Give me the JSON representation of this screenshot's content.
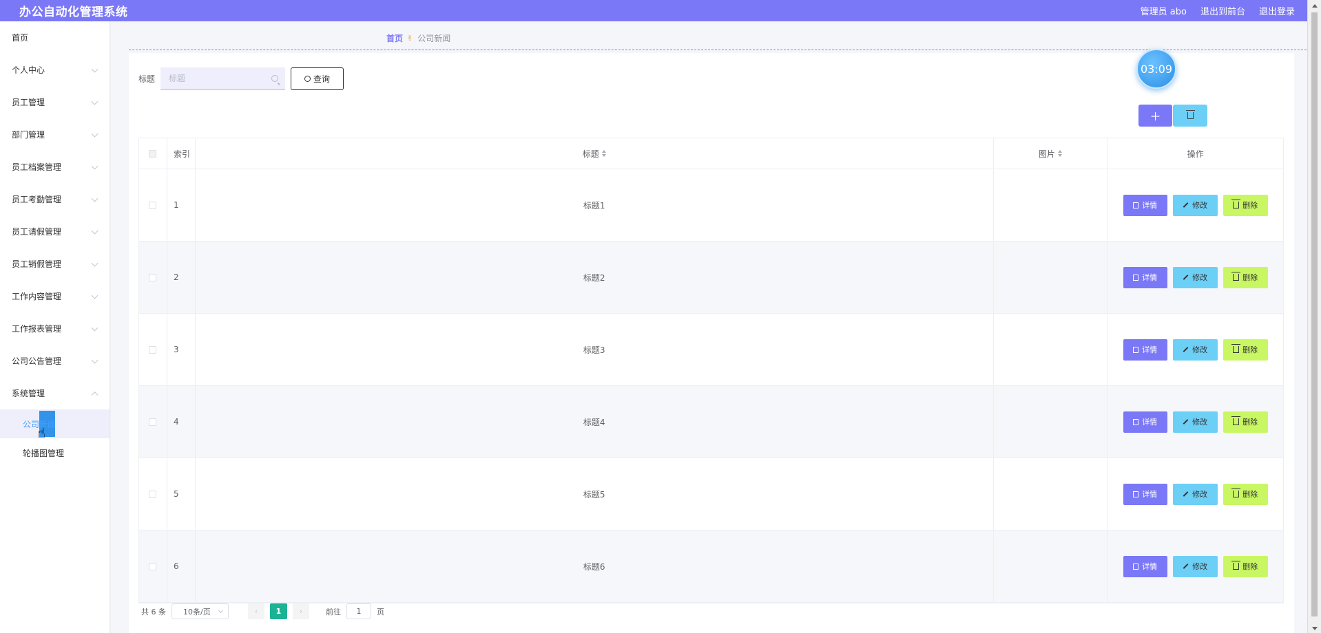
{
  "header": {
    "app_title": "办公自动化管理系统",
    "admin_label": "管理员 abo",
    "exit_front": "退出到前台",
    "logout": "退出登录"
  },
  "sidebar": {
    "items": [
      {
        "label": "首页",
        "expandable": false
      },
      {
        "label": "个人中心",
        "expandable": true
      },
      {
        "label": "员工管理",
        "expandable": true
      },
      {
        "label": "部门管理",
        "expandable": true
      },
      {
        "label": "员工档案管理",
        "expandable": true
      },
      {
        "label": "员工考勤管理",
        "expandable": true
      },
      {
        "label": "员工请假管理",
        "expandable": true
      },
      {
        "label": "员工销假管理",
        "expandable": true
      },
      {
        "label": "工作内容管理",
        "expandable": true
      },
      {
        "label": "工作报表管理",
        "expandable": true
      },
      {
        "label": "公司公告管理",
        "expandable": true
      },
      {
        "label": "系统管理",
        "expandable": true,
        "expanded": true
      }
    ],
    "subitems": [
      {
        "label": "公司新闻",
        "active": true
      },
      {
        "label": "轮播图管理",
        "active": false
      }
    ]
  },
  "breadcrumb": {
    "home": "首页",
    "current": "公司新闻"
  },
  "search": {
    "label": "标题",
    "placeholder": "标题",
    "value": "",
    "button_label": "查询"
  },
  "timer": "03:09",
  "toolbar": {
    "add_icon": "plus-icon",
    "delete_icon": "trash-icon"
  },
  "table": {
    "columns": [
      "索引",
      "标题",
      "图片",
      "操作"
    ],
    "rows": [
      {
        "index": "1",
        "title": "标题1",
        "image": ""
      },
      {
        "index": "2",
        "title": "标题2",
        "image": ""
      },
      {
        "index": "3",
        "title": "标题3",
        "image": ""
      },
      {
        "index": "4",
        "title": "标题4",
        "image": ""
      },
      {
        "index": "5",
        "title": "标题5",
        "image": ""
      },
      {
        "index": "6",
        "title": "标题6",
        "image": ""
      }
    ],
    "actions": {
      "detail": "详情",
      "edit": "修改",
      "delete": "删除"
    }
  },
  "pagination": {
    "total_text": "共 6 条",
    "page_size": "10条/页",
    "current_page": "1",
    "goto_label": "前往",
    "goto_value": "1",
    "page_suffix": "页"
  },
  "colors": {
    "primary": "#7b78f7",
    "info": "#6ccff6",
    "warning_green": "#c9f764",
    "page_active": "#1ab394"
  }
}
